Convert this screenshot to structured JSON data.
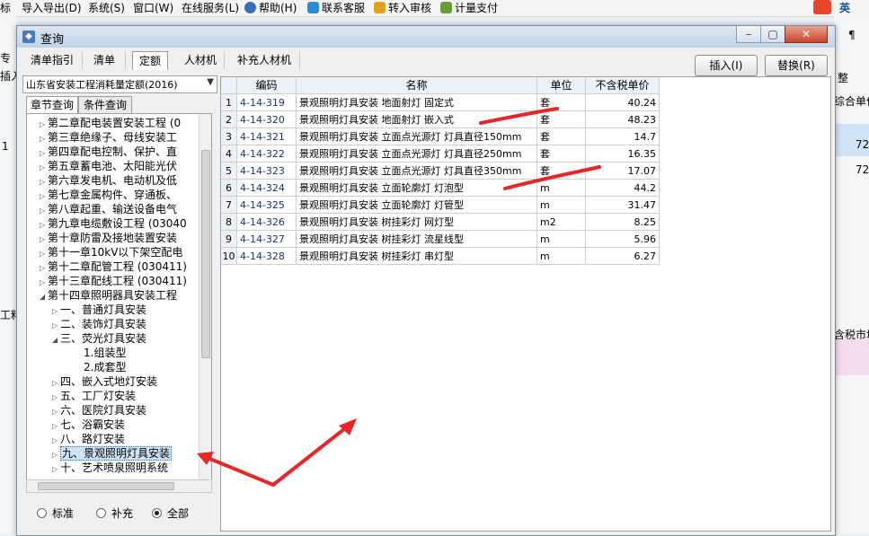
{
  "menubar": {
    "items": [
      {
        "label": "标"
      },
      {
        "label": "导入导出(D)"
      },
      {
        "label": "系统(S)"
      },
      {
        "label": "窗口(W)"
      },
      {
        "label": "在线服务(L)"
      },
      {
        "label": "帮助(H)"
      },
      {
        "label": "联系客服"
      },
      {
        "label": "转入审核"
      },
      {
        "label": "计量支付"
      }
    ],
    "ime_label": "英"
  },
  "background": {
    "left_fragments": [
      "专",
      "插入",
      "1",
      "工料"
    ],
    "right_fragments": [
      "整",
      "综合单价",
      "72",
      "72",
      "含税市场"
    ],
    "toolbar_glyph": "¶"
  },
  "dialog": {
    "title": "查询",
    "tabs": [
      "清单指引",
      "清单",
      "定额",
      "人材机",
      "补充人材机"
    ],
    "active_tab": "定额",
    "insert_button": "插入(I)",
    "replace_button": "替换(R)",
    "quota_select": "山东省安装工程消耗量定额(2016)",
    "sub_tabs": [
      "章节查询",
      "条件查询"
    ],
    "radio_options": [
      "标准",
      "补充",
      "全部"
    ],
    "radio_selected": "全部"
  },
  "tree": {
    "items": [
      {
        "label": "第二章配电装置安装工程 (0",
        "level": 0
      },
      {
        "label": "第三章绝缘子、母线安装工",
        "level": 0
      },
      {
        "label": "第四章配电控制、保护、直",
        "level": 0
      },
      {
        "label": "第五章蓄电池、太阳能光伏",
        "level": 0
      },
      {
        "label": "第六章发电机、电动机及低",
        "level": 0
      },
      {
        "label": "第七章金属构件、穿通板、",
        "level": 0
      },
      {
        "label": "第八章起重、输送设备电气",
        "level": 0
      },
      {
        "label": "第九章电缆敷设工程 (03040",
        "level": 0
      },
      {
        "label": "第十章防雷及接地装置安装",
        "level": 0
      },
      {
        "label": "第十一章10kV以下架空配电",
        "level": 0
      },
      {
        "label": "第十二章配管工程 (030411)",
        "level": 0
      },
      {
        "label": "第十三章配线工程 (030411)",
        "level": 0
      },
      {
        "label": "第十四章照明器具安装工程",
        "level": 0,
        "expanded": true
      },
      {
        "label": "一、普通灯具安装",
        "level": 1
      },
      {
        "label": "二、装饰灯具安装",
        "level": 1
      },
      {
        "label": "三、荧光灯具安装",
        "level": 1,
        "expanded": true
      },
      {
        "label": "1.组装型",
        "level": 2
      },
      {
        "label": "2.成套型",
        "level": 2
      },
      {
        "label": "四、嵌入式地灯安装",
        "level": 1
      },
      {
        "label": "五、工厂灯安装",
        "level": 1
      },
      {
        "label": "六、医院灯具安装",
        "level": 1
      },
      {
        "label": "七、浴霸安装",
        "level": 1
      },
      {
        "label": "八、路灯安装",
        "level": 1
      },
      {
        "label": "九、景观照明灯具安装",
        "level": 1,
        "selected": true
      },
      {
        "label": "十、艺术喷泉照明系统",
        "level": 1
      }
    ]
  },
  "grid": {
    "columns": [
      "编码",
      "名称",
      "单位",
      "不含税单价"
    ],
    "rows": [
      {
        "no": "1",
        "code": "4-14-319",
        "name": "景观照明灯具安装 地面射灯 固定式",
        "unit": "套",
        "price": "40.24"
      },
      {
        "no": "2",
        "code": "4-14-320",
        "name": "景观照明灯具安装 地面射灯 嵌入式",
        "unit": "套",
        "price": "48.23"
      },
      {
        "no": "3",
        "code": "4-14-321",
        "name": "景观照明灯具安装 立面点光源灯 灯具直径150mm",
        "unit": "套",
        "price": "14.7"
      },
      {
        "no": "4",
        "code": "4-14-322",
        "name": "景观照明灯具安装 立面点光源灯 灯具直径250mm",
        "unit": "套",
        "price": "16.35"
      },
      {
        "no": "5",
        "code": "4-14-323",
        "name": "景观照明灯具安装 立面点光源灯 灯具直径350mm",
        "unit": "套",
        "price": "17.07"
      },
      {
        "no": "6",
        "code": "4-14-324",
        "name": "景观照明灯具安装 立面轮廓灯 灯泡型",
        "unit": "m",
        "price": "44.2"
      },
      {
        "no": "7",
        "code": "4-14-325",
        "name": "景观照明灯具安装 立面轮廓灯 灯管型",
        "unit": "m",
        "price": "31.47"
      },
      {
        "no": "8",
        "code": "4-14-326",
        "name": "景观照明灯具安装 树挂彩灯 网灯型",
        "unit": "m2",
        "price": "8.25"
      },
      {
        "no": "9",
        "code": "4-14-327",
        "name": "景观照明灯具安装 树挂彩灯 流星线型",
        "unit": "m",
        "price": "5.96"
      },
      {
        "no": "10",
        "code": "4-14-328",
        "name": "景观照明灯具安装 树挂彩灯 串灯型",
        "unit": "m",
        "price": "6.27"
      }
    ]
  },
  "colors": {
    "annotation": "#e8262a",
    "selection": "#cfe3f7"
  }
}
